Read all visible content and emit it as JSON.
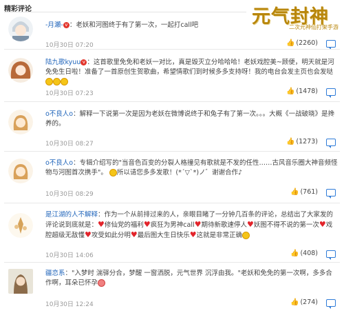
{
  "section_title": "精彩评论",
  "banner": {
    "title": "元气封神",
    "subtitle": "二次元神仙打架手游"
  },
  "colors": {
    "username": "#2266bb",
    "like_blue": "#2e7bd8",
    "heart": "#e2242b"
  },
  "comments": [
    {
      "user": "-月瀬-",
      "text": "：老妖和河图终于有了第一次，一起打call吧",
      "time": "10月30日 07:20",
      "likes": "(2260)"
    },
    {
      "user": "陆九歌kyuu",
      "text": "：这首歌里免免和老妖一对比，真是毁灭立分哈哈哈！老妖戏腔美~顾便，明天就是河免免生日啦！准备了一首原创生贺歌曲，希望情歌们到时候多多支持呀！我的电台会发主页也会发哒",
      "time": "10月30日 07:23",
      "likes": "(1478)"
    },
    {
      "user": "o不良人o",
      "text": "：解释一下说第一次是因为老妖在微博说终于和兔子有了第一次。。。大概《一战破晓》是搀养的。",
      "time": "10月30日 08:27",
      "likes": "(1273)"
    },
    {
      "user": "o不良人o",
      "text_a": "：专辑介绍写的\"当音色百变的分裂人格撞见有歌就是不发的任性……古风音乐圈大神音频怪物与河图首次携手\"。",
      "text_b": "所以请您多多发歌！(*´▽`*)ノ゛谢谢合作♪",
      "time": "10月30日 08:29",
      "likes": "(761)"
    },
    {
      "user": "是江湖的人不解释",
      "text_a": "：作为一个从前排过来的人，亲眼目睹了一分钟几百条的评论，总结出了大家发的评论说到底就是：",
      "segments": [
        "修仙党的福利",
        "疯狂为男神call",
        "期待新歌速停人",
        "妖图不得不说的第一次",
        "戏腔超级无敌懂",
        "攻受如此分明",
        "最后图大生日快乐",
        "这就是非常正确"
      ],
      "time": "10月30日 14:06",
      "likes": "(408)"
    },
    {
      "user": "疆恋系",
      "text": "：\"入梦时 湍驿分合，梦醒 一窗洒脱，元气世界 沉浮由我。\"老妖和免免的第一次啊，多多合作啊，耳朵已怀孕",
      "time": "10月30日 12:24",
      "likes": "(274)"
    }
  ]
}
